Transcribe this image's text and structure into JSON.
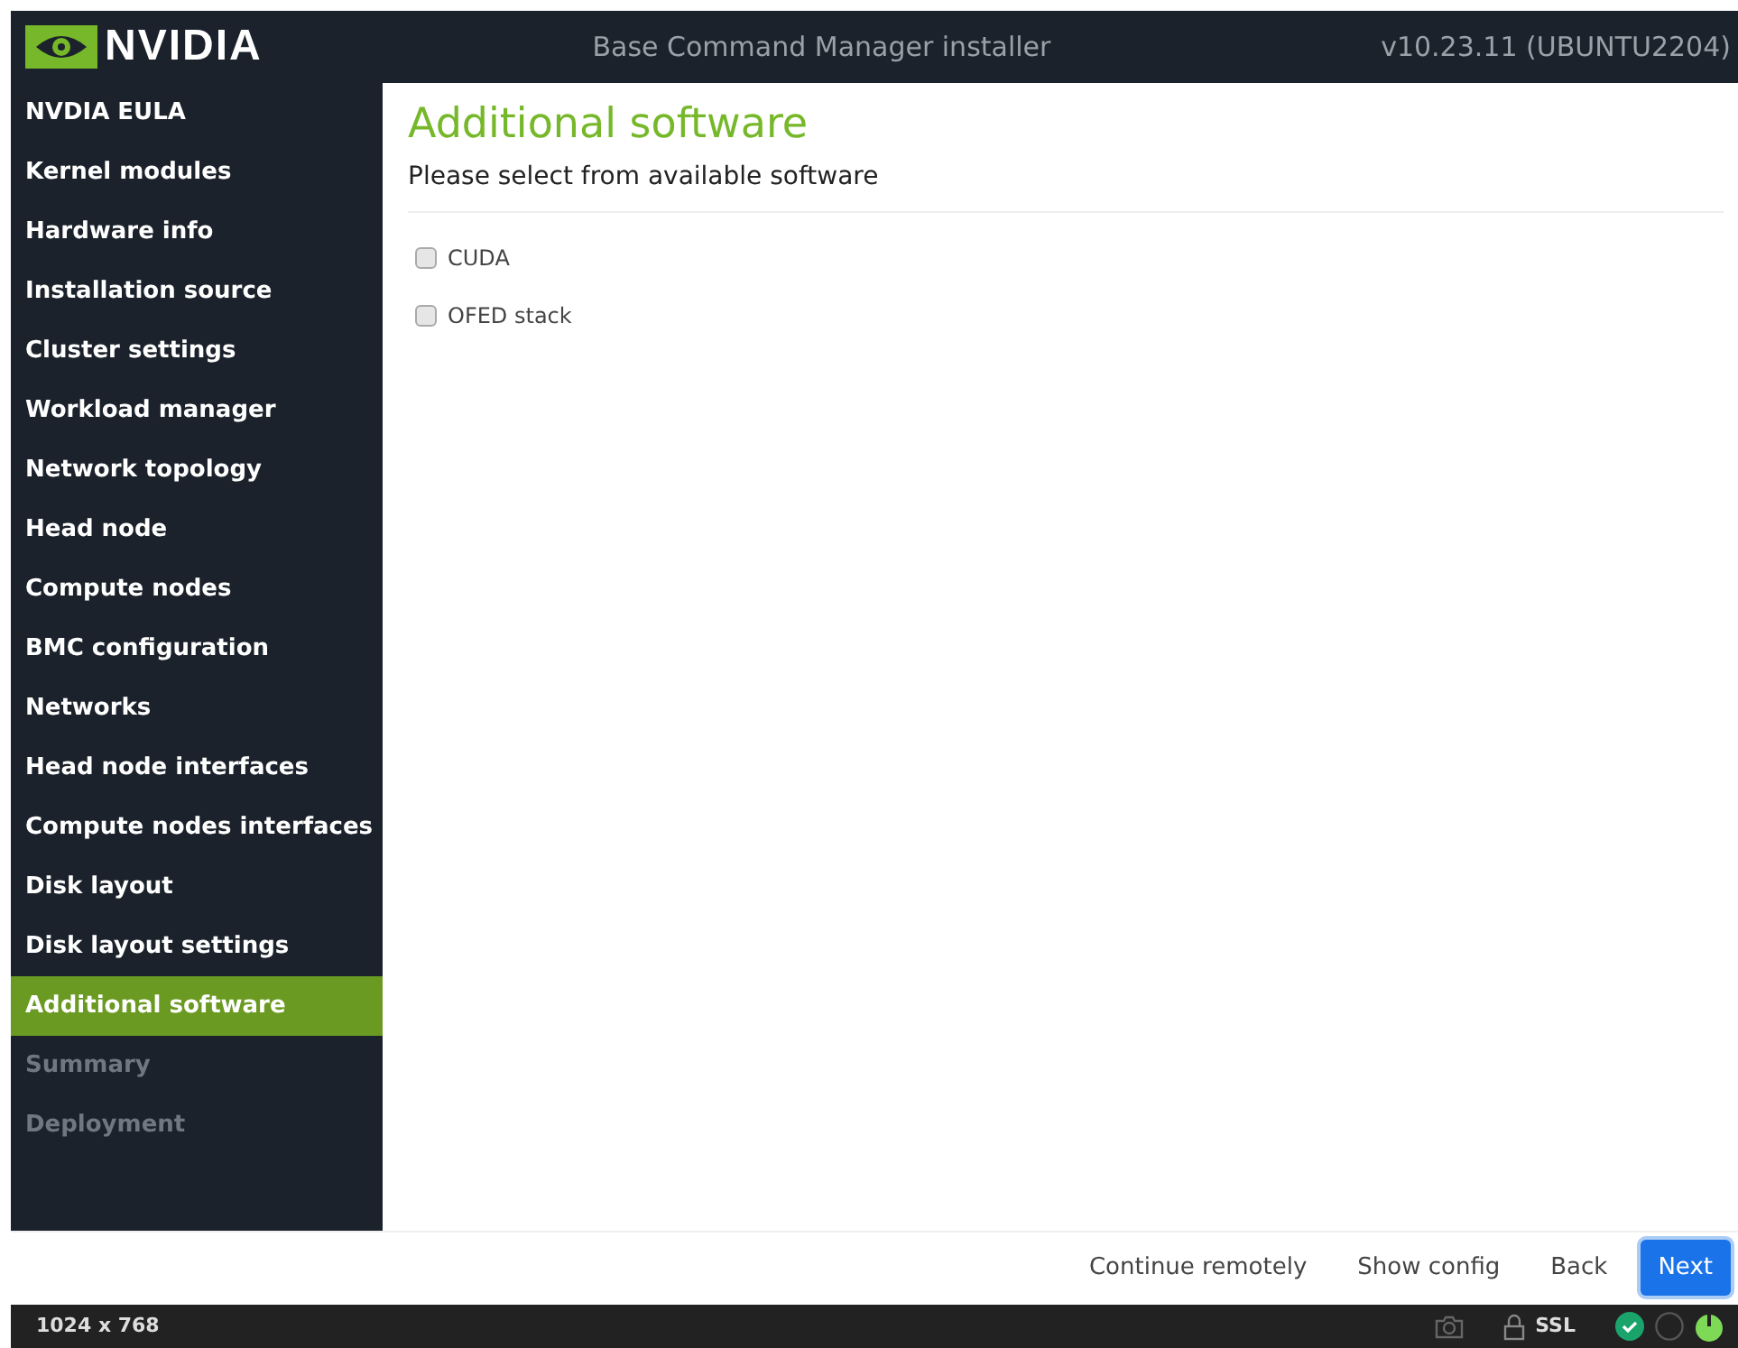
{
  "header": {
    "brand": "NVIDIA",
    "title": "Base Command Manager installer",
    "version": "v10.23.11 (UBUNTU2204)"
  },
  "sidebar": {
    "items": [
      {
        "label": "NVDIA EULA",
        "selected": false,
        "disabled": false
      },
      {
        "label": "Kernel modules",
        "selected": false,
        "disabled": false
      },
      {
        "label": "Hardware info",
        "selected": false,
        "disabled": false
      },
      {
        "label": "Installation source",
        "selected": false,
        "disabled": false
      },
      {
        "label": "Cluster settings",
        "selected": false,
        "disabled": false
      },
      {
        "label": "Workload manager",
        "selected": false,
        "disabled": false
      },
      {
        "label": "Network topology",
        "selected": false,
        "disabled": false
      },
      {
        "label": "Head node",
        "selected": false,
        "disabled": false
      },
      {
        "label": "Compute nodes",
        "selected": false,
        "disabled": false
      },
      {
        "label": "BMC configuration",
        "selected": false,
        "disabled": false
      },
      {
        "label": "Networks",
        "selected": false,
        "disabled": false
      },
      {
        "label": "Head node interfaces",
        "selected": false,
        "disabled": false
      },
      {
        "label": "Compute nodes interfaces",
        "selected": false,
        "disabled": false
      },
      {
        "label": "Disk layout",
        "selected": false,
        "disabled": false
      },
      {
        "label": "Disk layout settings",
        "selected": false,
        "disabled": false
      },
      {
        "label": "Additional software",
        "selected": true,
        "disabled": false
      },
      {
        "label": "Summary",
        "selected": false,
        "disabled": true
      },
      {
        "label": "Deployment",
        "selected": false,
        "disabled": true
      }
    ]
  },
  "content": {
    "title": "Additional software",
    "subtitle": "Please select from available software",
    "options": [
      {
        "label": "CUDA",
        "checked": false
      },
      {
        "label": "OFED stack",
        "checked": false
      }
    ]
  },
  "footer": {
    "buttons": [
      {
        "label": "Continue remotely",
        "kind": "link"
      },
      {
        "label": "Show config",
        "kind": "link"
      },
      {
        "label": "Back",
        "kind": "link"
      },
      {
        "label": "Next",
        "kind": "primary"
      }
    ]
  },
  "status_bar": {
    "resolution": "1024 x 768",
    "ssl": "SSL"
  }
}
